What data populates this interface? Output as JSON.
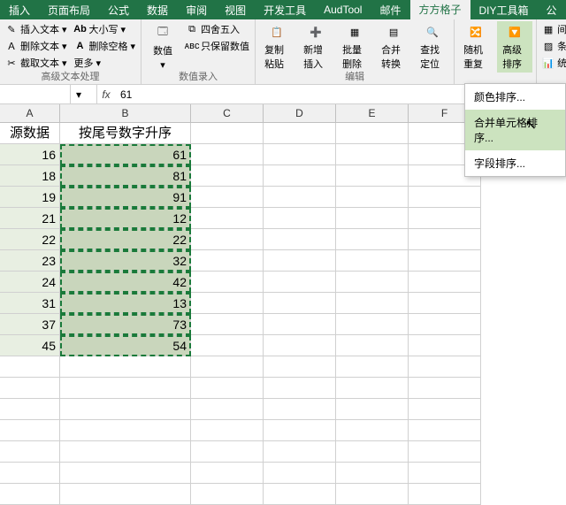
{
  "tabs": [
    "插入",
    "页面布局",
    "公式",
    "数据",
    "审阅",
    "视图",
    "开发工具",
    "AudTool",
    "邮件",
    "方方格子",
    "DIY工具箱",
    "公"
  ],
  "active_tab": 9,
  "ribbon": {
    "group1": {
      "items": [
        "插入文本",
        "删除文本",
        "截取文本",
        "更多"
      ],
      "items2": [
        "大小写",
        "删除空格"
      ],
      "label": "高级文本处理"
    },
    "group2": {
      "items": [
        "四舍五入",
        "只保留数值"
      ],
      "btn": "数值",
      "label": "数值录入"
    },
    "group3": {
      "btns": [
        "复制粘贴",
        "新增插入",
        "批量删除",
        "合并转换",
        "查找定位"
      ],
      "label": "编辑"
    },
    "group4": {
      "btns": [
        "随机重复",
        "高级排序"
      ]
    },
    "group5": {
      "items": [
        "间隔设定颜",
        "条件设定颜",
        "统计与分析"
      ]
    }
  },
  "dropdown": {
    "items": [
      "颜色排序...",
      "合并单元格排序...",
      "字段排序..."
    ],
    "highlighted": 1
  },
  "formula": {
    "name": "",
    "value": "61"
  },
  "columns": [
    "A",
    "B",
    "C",
    "D",
    "E",
    "F"
  ],
  "headers": {
    "A": "源数据",
    "B": "按尾号数字升序"
  },
  "rows": [
    {
      "A": "16",
      "B": "61"
    },
    {
      "A": "18",
      "B": "81"
    },
    {
      "A": "19",
      "B": "91"
    },
    {
      "A": "21",
      "B": "12"
    },
    {
      "A": "22",
      "B": "22"
    },
    {
      "A": "23",
      "B": "32"
    },
    {
      "A": "24",
      "B": "42"
    },
    {
      "A": "31",
      "B": "13"
    },
    {
      "A": "37",
      "B": "73"
    },
    {
      "A": "45",
      "B": "54"
    }
  ]
}
